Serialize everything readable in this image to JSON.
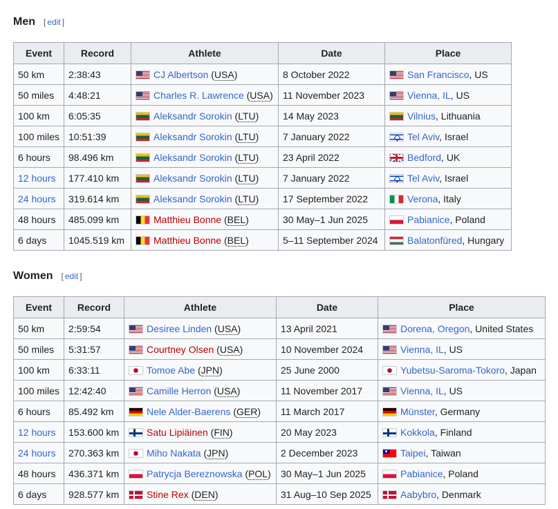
{
  "men": {
    "heading": "Men",
    "edit_label": "edit",
    "columns": [
      "Event",
      "Record",
      "Athlete",
      "Date",
      "Place"
    ],
    "rows": [
      {
        "event": "50 km",
        "event_link": false,
        "record": "2:38:43",
        "athlete_flag": "us",
        "athlete": "CJ Albertson",
        "athlete_link": "blue",
        "country": "USA",
        "date": "8 October 2022",
        "place_flag": "us",
        "place": "San Francisco",
        "place_rest": ", US"
      },
      {
        "event": "50 miles",
        "event_link": false,
        "record": "4:48:21",
        "athlete_flag": "us",
        "athlete": "Charles R. Lawrence",
        "athlete_link": "blue",
        "country": "USA",
        "date": "11 November 2023",
        "place_flag": "us",
        "place": "Vienna, IL",
        "place_rest": ", US"
      },
      {
        "event": "100 km",
        "event_link": false,
        "record": "6:05:35",
        "athlete_flag": "lt",
        "athlete": "Aleksandr Sorokin",
        "athlete_link": "blue",
        "country": "LTU",
        "date": "14 May 2023",
        "place_flag": "lt",
        "place": "Vilnius",
        "place_rest": ", Lithuania"
      },
      {
        "event": "100 miles",
        "event_link": false,
        "record": "10:51:39",
        "athlete_flag": "lt",
        "athlete": "Aleksandr Sorokin",
        "athlete_link": "blue",
        "country": "LTU",
        "date": "7 January 2022",
        "place_flag": "il",
        "place": "Tel Aviv",
        "place_rest": ", Israel"
      },
      {
        "event": "6 hours",
        "event_link": false,
        "record": "98.496 km",
        "athlete_flag": "lt",
        "athlete": "Aleksandr Sorokin",
        "athlete_link": "blue",
        "country": "LTU",
        "date": "23 April 2022",
        "place_flag": "gb",
        "place": "Bedford",
        "place_rest": ", UK"
      },
      {
        "event": "12 hours",
        "event_link": true,
        "record": "177.410 km",
        "athlete_flag": "lt",
        "athlete": "Aleksandr Sorokin",
        "athlete_link": "blue",
        "country": "LTU",
        "date": "7 January 2022",
        "place_flag": "il",
        "place": "Tel Aviv",
        "place_rest": ", Israel"
      },
      {
        "event": "24 hours",
        "event_link": true,
        "record": "319.614 km",
        "athlete_flag": "lt",
        "athlete": "Aleksandr Sorokin",
        "athlete_link": "blue",
        "country": "LTU",
        "date": "17 September 2022",
        "place_flag": "it",
        "place": "Verona",
        "place_rest": ", Italy"
      },
      {
        "event": "48 hours",
        "event_link": false,
        "record": "485.099 km",
        "athlete_flag": "be",
        "athlete": "Matthieu Bonne",
        "athlete_link": "red",
        "country": "BEL",
        "date": "30 May–1 Jun 2025",
        "place_flag": "pl",
        "place": "Pabianice",
        "place_rest": ", Poland"
      },
      {
        "event": "6 days",
        "event_link": false,
        "record": "1045.519 km",
        "athlete_flag": "be",
        "athlete": "Matthieu Bonne",
        "athlete_link": "red",
        "country": "BEL",
        "date": "5–11 September 2024",
        "place_flag": "hu",
        "place": "Balatonfüred",
        "place_rest": ", Hungary"
      }
    ]
  },
  "women": {
    "heading": "Women",
    "edit_label": "edit",
    "columns": [
      "Event",
      "Record",
      "Athlete",
      "Date",
      "Place"
    ],
    "rows": [
      {
        "event": "50 km",
        "event_link": false,
        "record": "2:59:54",
        "athlete_flag": "us",
        "athlete": "Desiree Linden",
        "athlete_link": "blue",
        "country": "USA",
        "date": "13 April 2021",
        "place_flag": "us",
        "place": "Dorena, Oregon",
        "place_rest": ", United States"
      },
      {
        "event": "50 miles",
        "event_link": false,
        "record": "5:31:57",
        "athlete_flag": "us",
        "athlete": "Courtney Olsen",
        "athlete_link": "red",
        "country": "USA",
        "date": "10 November 2024",
        "place_flag": "us",
        "place": "Vienna, IL",
        "place_rest": ", US"
      },
      {
        "event": "100 km",
        "event_link": false,
        "record": "6:33:11",
        "athlete_flag": "jp",
        "athlete": "Tomoe Abe",
        "athlete_link": "blue",
        "country": "JPN",
        "date": "25 June 2000",
        "place_flag": "jp",
        "place": "Yubetsu-Saroma-Tokoro",
        "place_rest": ", Japan"
      },
      {
        "event": "100 miles",
        "event_link": false,
        "record": "12:42:40",
        "athlete_flag": "us",
        "athlete": "Camille Herron",
        "athlete_link": "blue",
        "country": "USA",
        "date": "11 November 2017",
        "place_flag": "us",
        "place": "Vienna, IL",
        "place_rest": ", US"
      },
      {
        "event": "6 hours",
        "event_link": false,
        "record": "85.492 km",
        "athlete_flag": "de",
        "athlete": "Nele Alder-Baerens",
        "athlete_link": "blue",
        "country": "GER",
        "date": "11 March 2017",
        "place_flag": "de",
        "place": "Münster",
        "place_rest": ", Germany"
      },
      {
        "event": "12 hours",
        "event_link": true,
        "record": "153.600 km",
        "athlete_flag": "fi",
        "athlete": "Satu Lipiäinen",
        "athlete_link": "red",
        "country": "FIN",
        "date": "20 May 2023",
        "place_flag": "fi",
        "place": "Kokkola",
        "place_rest": ", Finland"
      },
      {
        "event": "24 hours",
        "event_link": true,
        "record": "270.363 km",
        "athlete_flag": "jp",
        "athlete": "Miho Nakata",
        "athlete_link": "blue",
        "country": "JPN",
        "date": "2 December 2023",
        "place_flag": "tw",
        "place": "Taipei",
        "place_rest": ", Taiwan"
      },
      {
        "event": "48 hours",
        "event_link": false,
        "record": "436.371 km",
        "athlete_flag": "pl",
        "athlete": "Patrycja Bereznowska",
        "athlete_link": "blue",
        "country": "POL",
        "date": "30 May–1 Jun 2025",
        "place_flag": "pl",
        "place": "Pabianice",
        "place_rest": ", Poland"
      },
      {
        "event": "6 days",
        "event_link": false,
        "record": "928.577 km",
        "athlete_flag": "dk",
        "athlete": "Stine Rex",
        "athlete_link": "red",
        "country": "DEN",
        "date": "31 Aug–10 Sep 2025",
        "place_flag": "dk",
        "place": "Aabybro",
        "place_rest": ", Denmark"
      }
    ]
  }
}
